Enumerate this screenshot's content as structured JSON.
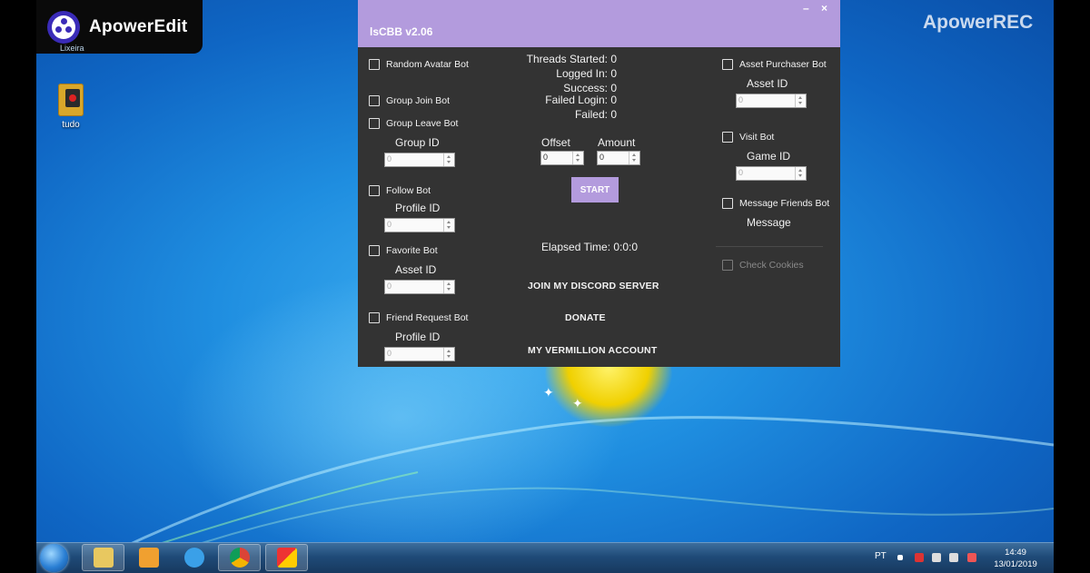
{
  "desktop": {
    "editor_brand": "ApowerEdit",
    "recycle_label": "Lixeira",
    "recorder_brand": "ApowerREC",
    "icon_label": "tudo"
  },
  "app": {
    "title": "lsCBB v2.06",
    "minimize": "–",
    "close": "×",
    "left_column": {
      "random_avatar": "Random Avatar Bot",
      "group_join": "Group Join Bot",
      "group_leave": "Group Leave Bot",
      "group_id_label": "Group ID",
      "group_id_value": "0",
      "follow": "Follow Bot",
      "follow_profile_label": "Profile ID",
      "follow_profile_value": "0",
      "favorite": "Favorite Bot",
      "favorite_asset_label": "Asset ID",
      "favorite_asset_value": "0",
      "friend_request": "Friend Request Bot",
      "friend_profile_label": "Profile ID",
      "friend_profile_value": "0"
    },
    "center_column": {
      "threads_started": "Threads Started: 0",
      "logged_in": "Logged In: 0",
      "success": "Success: 0",
      "failed_login": "Failed Login: 0",
      "failed": "Failed: 0",
      "offset_label": "Offset",
      "offset_value": "0",
      "amount_label": "Amount",
      "amount_value": "0",
      "start_label": "START",
      "elapsed": "Elapsed Time: 0:0:0",
      "discord": "JOIN MY DISCORD SERVER",
      "donate": "DONATE",
      "vermillion": "MY VERMILLION ACCOUNT"
    },
    "right_column": {
      "asset_purchaser": "Asset Purchaser Bot",
      "asset_id_label": "Asset ID",
      "asset_id_value": "0",
      "visit": "Visit Bot",
      "game_id_label": "Game ID",
      "game_id_value": "0",
      "message_friends": "Message Friends Bot",
      "message_label": "Message",
      "check_cookies": "Check Cookies"
    }
  },
  "taskbar": {
    "language": "PT",
    "time": "14:49",
    "date": "13/01/2019"
  }
}
